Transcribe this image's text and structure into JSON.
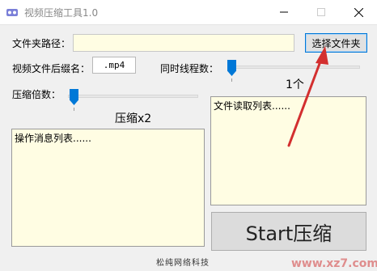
{
  "window": {
    "title": "视频压缩工具1.0"
  },
  "form": {
    "folder_path_label": "文件夹路径：",
    "folder_path_value": "",
    "select_folder_button": "选择文件夹",
    "suffix_label": "视频文件后缀名：",
    "suffix_value": ".mp4",
    "threads_label": "同时线程数：",
    "threads_value_display": "1个",
    "threads_level": 0,
    "compress_label": "压缩倍数：",
    "compress_value_display": "压缩x2",
    "compress_level": 0
  },
  "lists": {
    "file_list_placeholder": "文件读取列表......",
    "message_list_placeholder": "操作消息列表......"
  },
  "start_button": "Start压缩",
  "footer": "松纯网络科技",
  "watermark": "www.xz7.com",
  "colors": {
    "accent": "#0078d7",
    "arrow": "#d32f2f",
    "textbox_bg": "#fffde3"
  }
}
